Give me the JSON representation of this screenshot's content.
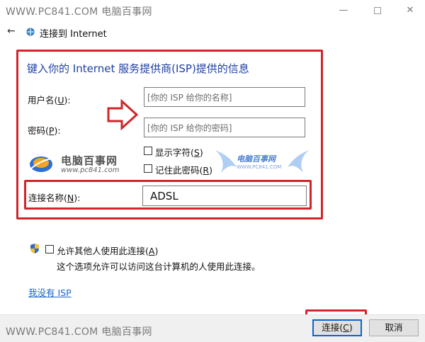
{
  "window": {
    "watermark": "WWW.PC841.COM 电脑百事网",
    "minimize": "—",
    "close": "✕"
  },
  "nav": {
    "back": "←",
    "title": "连接到 Internet"
  },
  "main": {
    "heading": "键入你的 Internet 服务提供商(ISP)提供的信息",
    "username": {
      "label_pre": "用户名(",
      "label_key": "U",
      "label_post": "):",
      "placeholder": "[你的 ISP 给你的名称]"
    },
    "password": {
      "label_pre": "密码(",
      "label_key": "P",
      "label_post": "):",
      "placeholder": "[你的 ISP 给你的密码]"
    },
    "show_chars": {
      "label_pre": "显示字符(",
      "label_key": "S",
      "label_post": ")",
      "checked": false
    },
    "remember": {
      "label_pre": "记住此密码(",
      "label_key": "R",
      "label_post": ")",
      "checked": false
    },
    "connection_name": {
      "label_pre": "连接名称(",
      "label_key": "N",
      "label_post": "):",
      "value": "ADSL"
    }
  },
  "watermark_logos": {
    "left_text": "电脑百事网",
    "left_url": "www.pc841.com",
    "right_text": "电脑百事网",
    "right_url": "WWW.PC841.COM"
  },
  "allow": {
    "label_pre": "允许其他人使用此连接(",
    "label_key": "A",
    "label_post": ")",
    "description": "这个选项允许可以访问这台计算机的人使用此连接。",
    "checked": false
  },
  "links": {
    "no_isp": "我没有 ISP"
  },
  "footer": {
    "watermark": "WWW.PC841.COM 电脑百事网",
    "connect_pre": "连接(",
    "connect_key": "C",
    "connect_post": ")",
    "cancel": "取消"
  },
  "colors": {
    "heading": "#1e3fa3",
    "highlight_red": "#d0262a",
    "link_blue": "#1a63c9",
    "default_button_border": "#0a64d0"
  }
}
